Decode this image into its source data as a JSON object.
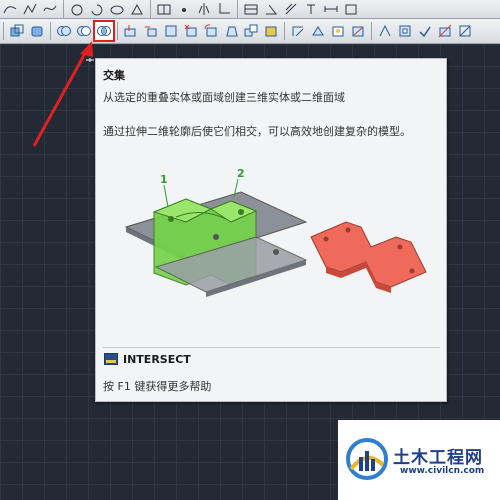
{
  "tooltip": {
    "title": "交集",
    "description": "从选定的重叠实体或面域创建三维实体或二维面域",
    "detail": "通过拉伸二维轮廓后使它们相交，可以高效地创建复杂的模型。",
    "callout_1": "1",
    "callout_2": "2",
    "command": "INTERSECT",
    "help": "按 F1 键获得更多帮助"
  },
  "watermark": {
    "name": "土木工程网",
    "url": "www.civilcn.com"
  },
  "colors": {
    "arrow": "#e02020",
    "highlight": "#e02020",
    "solid_green": "#74d44a",
    "solid_red": "#ef6a5a"
  }
}
